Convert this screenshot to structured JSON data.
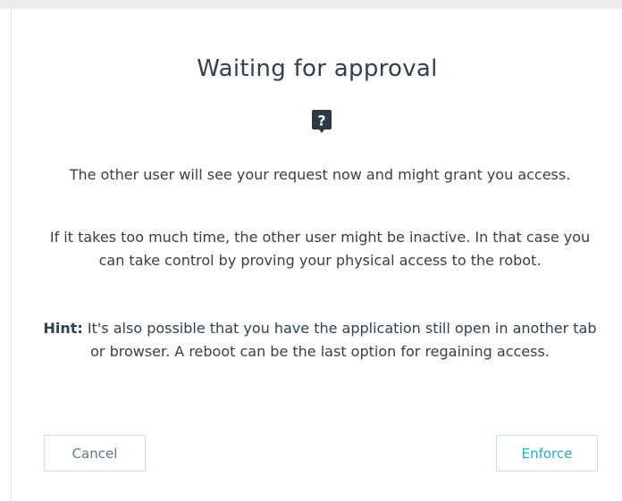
{
  "dialog": {
    "title": "Waiting for approval",
    "icon": "question-bubble-icon",
    "message": "The other user will see your request now and might grant you access.",
    "inactive_note": "If it takes too much time, the other user might be inactive. In that case you can take control by proving your physical access to the robot.",
    "hint_label": "Hint:",
    "hint_text": " It's also possible that you have the application still open in another tab or browser. A reboot can be the last option for regaining access.",
    "buttons": {
      "cancel": "Cancel",
      "enforce": "Enforce"
    }
  },
  "colors": {
    "text": "#33414d",
    "accent": "#2ba8c4",
    "icon": "#2d3a44"
  }
}
